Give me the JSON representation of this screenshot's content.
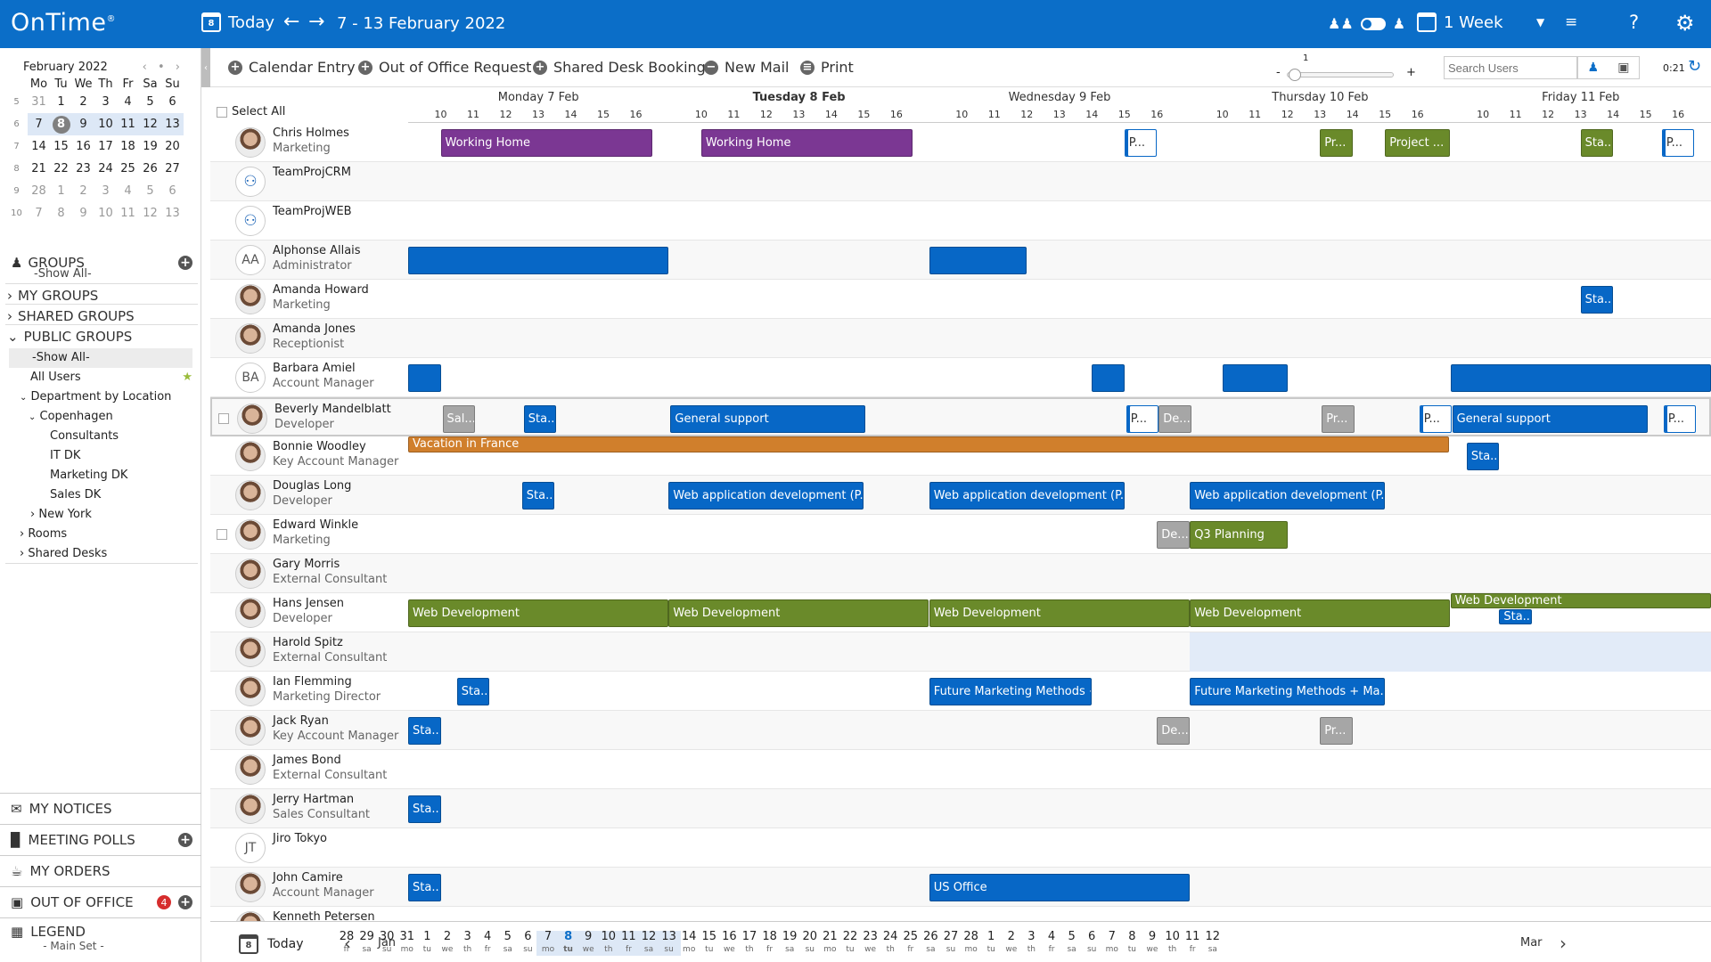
{
  "app": {
    "logo": "OnTime",
    "logo_mark": "®"
  },
  "topbar": {
    "today_label": "Today",
    "cal_icon_day": "8",
    "date_range": "7 - 13 February 2022",
    "view_label": "1 Week",
    "help_label": "?"
  },
  "minical": {
    "month": "February 2022",
    "nav": "‹ • ›",
    "weekdays": [
      "Mo",
      "Tu",
      "We",
      "Th",
      "Fr",
      "Sa",
      "Su"
    ],
    "weeks": [
      {
        "wk": "5",
        "days": [
          "31",
          "1",
          "2",
          "3",
          "4",
          "5",
          "6"
        ]
      },
      {
        "wk": "6",
        "days": [
          "7",
          "8",
          "9",
          "10",
          "11",
          "12",
          "13"
        ]
      },
      {
        "wk": "7",
        "days": [
          "14",
          "15",
          "16",
          "17",
          "18",
          "19",
          "20"
        ]
      },
      {
        "wk": "8",
        "days": [
          "21",
          "22",
          "23",
          "24",
          "25",
          "26",
          "27"
        ]
      },
      {
        "wk": "9",
        "days": [
          "28",
          "1",
          "2",
          "3",
          "4",
          "5",
          "6"
        ]
      },
      {
        "wk": "10",
        "days": [
          "7",
          "8",
          "9",
          "10",
          "11",
          "12",
          "13"
        ]
      }
    ]
  },
  "leftpanel": {
    "groups_label": "GROUPS",
    "groups_sub": "-Show All-",
    "my_groups": "MY GROUPS",
    "shared_groups": "SHARED GROUPS",
    "public_groups": "PUBLIC GROUPS",
    "tree": [
      "-Show All-",
      "All Users",
      "Department by Location",
      "Copenhagen",
      "Consultants",
      "IT DK",
      "Marketing DK",
      "Sales DK",
      "New York",
      "Rooms",
      "Shared Desks"
    ],
    "my_notices": "MY NOTICES",
    "meeting_polls": "MEETING POLLS",
    "my_orders": "MY ORDERS",
    "out_of_office": "OUT OF OFFICE",
    "out_of_office_count": "4",
    "legend": "LEGEND",
    "legend_sub": "- Main Set -"
  },
  "actions": {
    "calendar_entry": "Calendar Entry",
    "out_of_office": "Out of Office Request",
    "shared_desk": "Shared Desk Booking",
    "new_mail": "New Mail",
    "print": "Print",
    "zoom_value": "1",
    "zoom_minus": "-",
    "zoom_plus": "+",
    "search_placeholder": "Search Users",
    "refresh_time": "0:21"
  },
  "grid": {
    "select_all": "Select All",
    "days": [
      {
        "label": "Monday 7 Feb",
        "current": false
      },
      {
        "label": "Tuesday 8 Feb",
        "current": true
      },
      {
        "label": "Wednesday 9 Feb",
        "current": false
      },
      {
        "label": "Thursday 10 Feb",
        "current": false
      },
      {
        "label": "Friday 11 Feb",
        "current": false
      }
    ],
    "hours": [
      "10",
      "11",
      "12",
      "13",
      "14",
      "15",
      "16"
    ]
  },
  "people": [
    {
      "name": "Chris Holmes",
      "role": "Marketing",
      "avatar": "face",
      "events": [
        {
          "day": 0,
          "start": 10,
          "end": 16.5,
          "label": "Working Home",
          "color": "purple"
        },
        {
          "day": 1,
          "start": 10,
          "end": 16.5,
          "label": "Working Home",
          "color": "purple"
        },
        {
          "day": 2,
          "start": 15,
          "end": 16,
          "label": "P...",
          "color": "white"
        },
        {
          "day": 3,
          "start": 13,
          "end": 14,
          "label": "Pr...",
          "color": "green"
        },
        {
          "day": 3,
          "start": 15,
          "end": 17,
          "label": "Project ...",
          "color": "green"
        },
        {
          "day": 4,
          "start": 13,
          "end": 14,
          "label": "Sta...",
          "color": "green"
        },
        {
          "day": 4,
          "start": 15.5,
          "end": 16.5,
          "label": "P...",
          "color": "white"
        }
      ]
    },
    {
      "name": "TeamProjCRM",
      "role": "",
      "avatar": "group",
      "events": []
    },
    {
      "name": "TeamProjWEB",
      "role": "",
      "avatar": "group",
      "events": []
    },
    {
      "name": "Alphonse Allais",
      "role": "Administrator",
      "avatar": "initials",
      "initials": "AA",
      "events": [
        {
          "day": 0,
          "start": 9,
          "end": 17,
          "label": "",
          "color": "blue"
        },
        {
          "day": 2,
          "start": 9,
          "end": 12,
          "label": "",
          "color": "blue"
        }
      ]
    },
    {
      "name": "Amanda Howard",
      "role": "Marketing",
      "avatar": "face",
      "events": [
        {
          "day": 4,
          "start": 13,
          "end": 14,
          "label": "Sta...",
          "color": "blue"
        }
      ]
    },
    {
      "name": "Amanda Jones",
      "role": "Receptionist",
      "avatar": "face",
      "events": []
    },
    {
      "name": "Barbara Amiel",
      "role": "Account Manager",
      "avatar": "initials",
      "initials": "BA",
      "events": [
        {
          "day": 0,
          "start": 9,
          "end": 10,
          "label": "",
          "color": "blue"
        },
        {
          "day": 2,
          "start": 14,
          "end": 15,
          "label": "",
          "color": "blue"
        },
        {
          "day": 3,
          "start": 10,
          "end": 12,
          "label": "",
          "color": "blue"
        },
        {
          "day": 4,
          "start": 9,
          "end": 17,
          "label": "",
          "color": "blue"
        }
      ]
    },
    {
      "name": "Beverly Mandelblatt",
      "role": "Developer",
      "avatar": "face",
      "highlight": true,
      "events": [
        {
          "day": 0,
          "start": 10,
          "end": 11,
          "label": "Sal...",
          "color": "gray"
        },
        {
          "day": 0,
          "start": 12.5,
          "end": 13.5,
          "label": "Sta...",
          "color": "blue"
        },
        {
          "day": 1,
          "start": 9,
          "end": 15,
          "label": "General support",
          "color": "blue"
        },
        {
          "day": 2,
          "start": 15,
          "end": 16,
          "label": "P...",
          "color": "white"
        },
        {
          "day": 2,
          "start": 16,
          "end": 17,
          "label": "De...",
          "color": "gray"
        },
        {
          "day": 3,
          "start": 13,
          "end": 14,
          "label": "Pr...",
          "color": "gray"
        },
        {
          "day": 3,
          "start": 16,
          "end": 17,
          "label": "P...",
          "color": "white"
        },
        {
          "day": 4,
          "start": 9,
          "end": 15,
          "label": "General support",
          "color": "blue"
        },
        {
          "day": 4,
          "start": 15.5,
          "end": 16.5,
          "label": "P...",
          "color": "white"
        }
      ]
    },
    {
      "name": "Bonnie Woodley",
      "role": "Key Account Manager",
      "avatar": "face",
      "events": [
        {
          "day": 0,
          "start": 9,
          "end": 41,
          "label": "Vacation in France",
          "color": "orange"
        },
        {
          "day": 4,
          "start": 9.5,
          "end": 10.5,
          "label": "Sta...",
          "color": "blue"
        }
      ]
    },
    {
      "name": "Douglas Long",
      "role": "Developer",
      "avatar": "face",
      "events": [
        {
          "day": 0,
          "start": 12.5,
          "end": 13.5,
          "label": "Sta...",
          "color": "blue"
        },
        {
          "day": 1,
          "start": 9,
          "end": 15,
          "label": "Web application development (P...",
          "color": "blue"
        },
        {
          "day": 2,
          "start": 9,
          "end": 15,
          "label": "Web application development (P...",
          "color": "blue"
        },
        {
          "day": 3,
          "start": 9,
          "end": 15,
          "label": "Web application development (P...",
          "color": "blue"
        }
      ]
    },
    {
      "name": "Edward Winkle",
      "role": "Marketing",
      "avatar": "face",
      "events": [
        {
          "day": 2,
          "start": 16,
          "end": 17,
          "label": "De...",
          "color": "gray"
        },
        {
          "day": 3,
          "start": 9,
          "end": 12,
          "label": "Q3 Planning",
          "color": "green"
        }
      ]
    },
    {
      "name": "Gary Morris",
      "role": "External Consultant",
      "avatar": "face",
      "events": []
    },
    {
      "name": "Hans Jensen",
      "role": "Developer",
      "avatar": "face",
      "events": [
        {
          "day": 0,
          "start": 9,
          "end": 17,
          "label": "Web Development",
          "color": "green"
        },
        {
          "day": 1,
          "start": 9,
          "end": 17,
          "label": "Web Development",
          "color": "green"
        },
        {
          "day": 2,
          "start": 9,
          "end": 17,
          "label": "Web Development",
          "color": "green"
        },
        {
          "day": 3,
          "start": 9,
          "end": 17,
          "label": "Web Development",
          "color": "green"
        },
        {
          "day": 4,
          "start": 9,
          "end": 17,
          "label": "Web Development",
          "color": "green",
          "thin": true
        },
        {
          "day": 4,
          "start": 10.5,
          "end": 11.5,
          "label": "Sta...",
          "color": "blue",
          "thin": true,
          "offset": 18
        }
      ]
    },
    {
      "name": "Harold Spitz",
      "role": "External Consultant",
      "avatar": "face",
      "events": []
    },
    {
      "name": "Ian Flemming",
      "role": "Marketing Director",
      "avatar": "face",
      "events": [
        {
          "day": 0,
          "start": 10.5,
          "end": 11.5,
          "label": "Sta...",
          "color": "blue"
        },
        {
          "day": 2,
          "start": 9,
          "end": 14,
          "label": "Future Marketing Methods + Ma...",
          "color": "blue"
        },
        {
          "day": 3,
          "start": 9,
          "end": 15,
          "label": "Future Marketing Methods + Ma...",
          "color": "blue"
        }
      ]
    },
    {
      "name": "Jack Ryan",
      "role": "Key Account Manager",
      "avatar": "face",
      "events": [
        {
          "day": 0,
          "start": 9,
          "end": 10,
          "label": "Sta...",
          "color": "blue"
        },
        {
          "day": 2,
          "start": 16,
          "end": 17,
          "label": "De...",
          "color": "gray"
        },
        {
          "day": 3,
          "start": 13,
          "end": 14,
          "label": "Pr...",
          "color": "gray"
        }
      ]
    },
    {
      "name": "James Bond",
      "role": "External Consultant",
      "avatar": "face",
      "events": []
    },
    {
      "name": "Jerry Hartman",
      "role": "Sales Consultant",
      "avatar": "face",
      "events": [
        {
          "day": 0,
          "start": 9,
          "end": 10,
          "label": "Sta...",
          "color": "blue"
        }
      ]
    },
    {
      "name": "Jiro Tokyo",
      "role": "",
      "avatar": "initials",
      "initials": "JT",
      "events": []
    },
    {
      "name": "John Camire",
      "role": "Account Manager",
      "avatar": "face",
      "events": [
        {
          "day": 0,
          "start": 9,
          "end": 10,
          "label": "Sta...",
          "color": "blue"
        },
        {
          "day": 2,
          "start": 9,
          "end": 17,
          "label": "US Office",
          "color": "blue"
        }
      ]
    },
    {
      "name": "Kenneth Petersen",
      "role": "",
      "avatar": "face",
      "events": []
    }
  ],
  "timeline": {
    "today_label": "Today",
    "month_left": "Jan",
    "month_right": "Mar",
    "days": [
      [
        "28",
        "fr"
      ],
      [
        "29",
        "sa"
      ],
      [
        "30",
        "su"
      ],
      [
        "31",
        "mo"
      ],
      [
        "1",
        "tu"
      ],
      [
        "2",
        "we"
      ],
      [
        "3",
        "th"
      ],
      [
        "4",
        "fr"
      ],
      [
        "5",
        "sa"
      ],
      [
        "6",
        "su"
      ],
      [
        "7",
        "mo"
      ],
      [
        "8",
        "tu"
      ],
      [
        "9",
        "we"
      ],
      [
        "10",
        "th"
      ],
      [
        "11",
        "fr"
      ],
      [
        "12",
        "sa"
      ],
      [
        "13",
        "su"
      ],
      [
        "14",
        "mo"
      ],
      [
        "15",
        "tu"
      ],
      [
        "16",
        "we"
      ],
      [
        "17",
        "th"
      ],
      [
        "18",
        "fr"
      ],
      [
        "19",
        "sa"
      ],
      [
        "20",
        "su"
      ],
      [
        "21",
        "mo"
      ],
      [
        "22",
        "tu"
      ],
      [
        "23",
        "we"
      ],
      [
        "24",
        "th"
      ],
      [
        "25",
        "fr"
      ],
      [
        "26",
        "sa"
      ],
      [
        "27",
        "su"
      ],
      [
        "28",
        "mo"
      ],
      [
        "1",
        "tu"
      ],
      [
        "2",
        "we"
      ],
      [
        "3",
        "th"
      ],
      [
        "4",
        "fr"
      ],
      [
        "5",
        "sa"
      ],
      [
        "6",
        "su"
      ],
      [
        "7",
        "mo"
      ],
      [
        "8",
        "tu"
      ],
      [
        "9",
        "we"
      ],
      [
        "10",
        "th"
      ],
      [
        "11",
        "fr"
      ],
      [
        "12",
        "sa"
      ]
    ]
  }
}
